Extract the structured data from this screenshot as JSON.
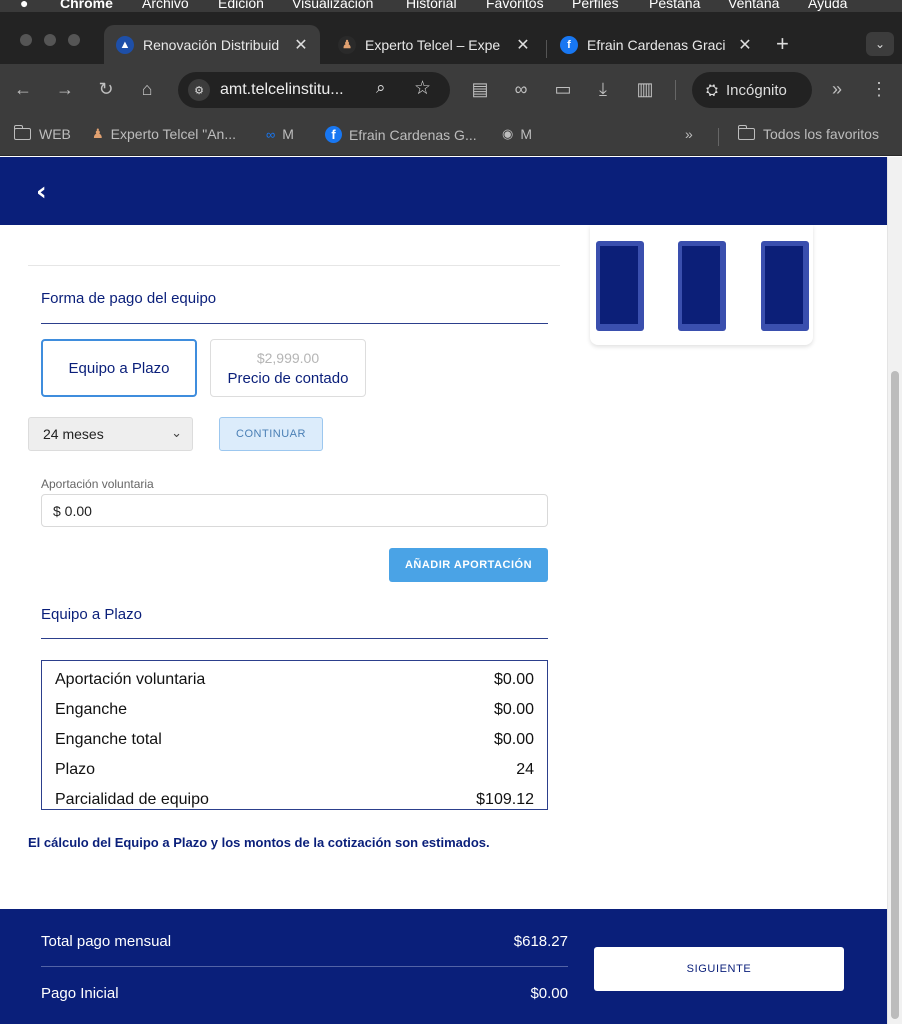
{
  "mac_menu": {
    "app": "Chrome",
    "items": [
      "Archivo",
      "Edición",
      "Visualización",
      "Historial",
      "Favoritos",
      "Perfiles",
      "Pestaña",
      "Ventana",
      "Ayuda"
    ]
  },
  "tabs": [
    {
      "title": "Renovación Distribuid",
      "active": true,
      "close": "✕"
    },
    {
      "title": "Experto Telcel – Expe",
      "active": false,
      "close": "✕"
    },
    {
      "title": "Efrain Cardenas Graci",
      "active": false,
      "close": "✕"
    }
  ],
  "toolbar": {
    "url": "amt.telcelinstitu...",
    "incognito_label": "Incógnito"
  },
  "bookmarks": {
    "items": [
      "WEB",
      "Experto Telcel \"An...",
      "M",
      "Efrain Cardenas G...",
      "M"
    ],
    "overflow": "»",
    "all_label": "Todos los favoritos"
  },
  "page": {
    "back_icon": "‹",
    "payment_title": "Forma de pago del equipo",
    "option_selected": "Equipo a Plazo",
    "option_cash_price": "$2,999.00",
    "option_cash_label": "Precio de contado",
    "months_select": "24 meses",
    "continue_button": "CONTINUAR",
    "contribution_label": "Aportación voluntaria",
    "contribution_value": "$ 0.00",
    "add_contribution_button": "AÑADIR APORTACIÓN",
    "summary_title": "Equipo a Plazo",
    "summary_rows": [
      {
        "label": "Aportación voluntaria",
        "value": "$0.00"
      },
      {
        "label": "Enganche",
        "value": "$0.00"
      },
      {
        "label": "Enganche total",
        "value": "$0.00"
      },
      {
        "label": "Plazo",
        "value": "24"
      },
      {
        "label": "Parcialidad de equipo",
        "value": "$109.12"
      }
    ],
    "note": "El cálculo del Equipo a Plazo y los montos de la cotización son estimados."
  },
  "footer": {
    "monthly_label": "Total pago mensual",
    "monthly_value": "$618.27",
    "initial_label": "Pago Inicial",
    "initial_value": "$0.00",
    "next_button": "SIGUIENTE"
  },
  "colors": {
    "brand_navy": "#0a1f7a",
    "accent_blue": "#4aa3e6"
  }
}
